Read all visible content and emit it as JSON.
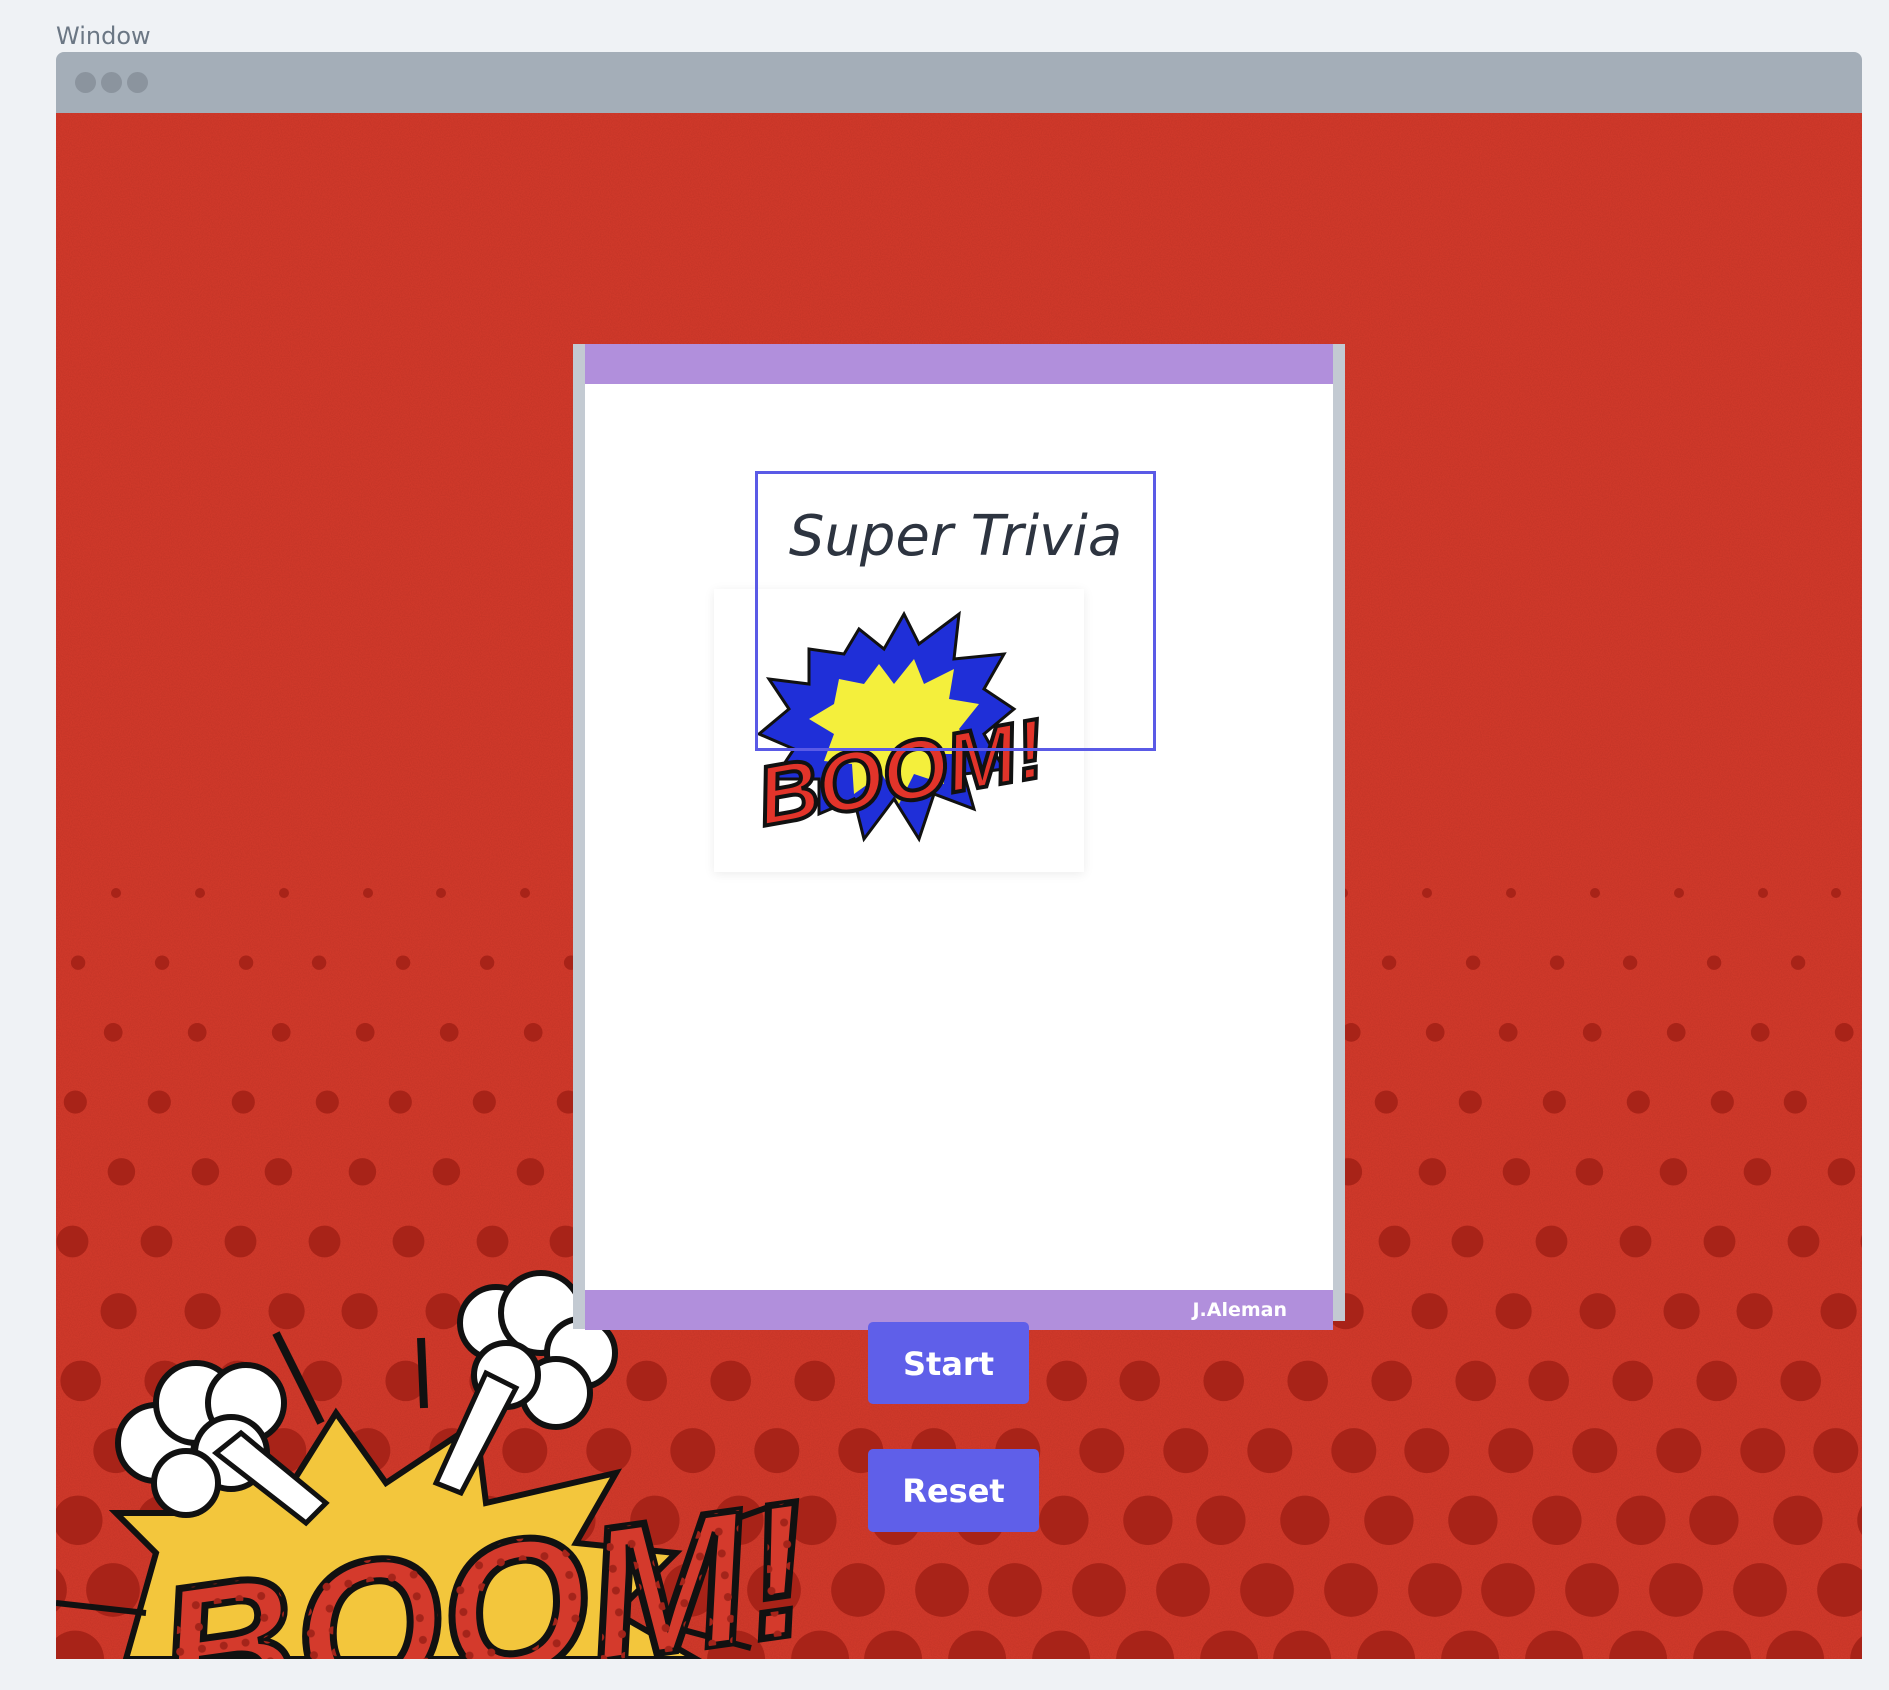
{
  "window": {
    "label": "Window"
  },
  "app": {
    "title": "Super Trivia",
    "author": "J.Aleman"
  },
  "buttons": {
    "start_label": "Start",
    "reset_label": "Reset"
  },
  "illustrations": {
    "center_badge_text": "BOOM!",
    "bottom_left_text": "BOOM!"
  },
  "colors": {
    "background_red": "#d63a2b",
    "dot_red": "#a82318",
    "card_band": "#b18fdc",
    "button": "#5f5fe9",
    "title_box_border": "#5a5ae6",
    "titlebar": "#a4aeb8"
  }
}
